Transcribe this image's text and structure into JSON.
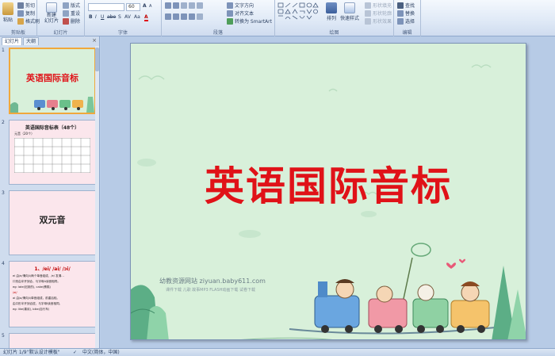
{
  "ribbon": {
    "clipboard": {
      "label": "剪贴板",
      "paste": "粘贴",
      "cut": "剪切",
      "copy": "复制",
      "format_painter": "格式刷"
    },
    "slides": {
      "label": "幻灯片",
      "new_slide_line1": "新建",
      "new_slide_line2": "幻灯片",
      "layout": "版式",
      "reset": "重设",
      "delete": "删除"
    },
    "font": {
      "label": "字体",
      "font_name": "",
      "font_size": "60",
      "grow": "A",
      "shrink": "A",
      "bold": "B",
      "italic": "I",
      "underline": "U",
      "strike": "abe",
      "shadow": "S",
      "spacing": "AV",
      "case": "Aa",
      "color": "A"
    },
    "paragraph": {
      "label": "段落",
      "text_direction": "文字方向",
      "align_text": "对齐文本",
      "smartart": "转换为 SmartArt"
    },
    "drawing": {
      "label": "绘图",
      "arrange": "排列",
      "quick_styles": "快速样式",
      "shape_fill": "形状填充",
      "shape_outline": "形状轮廓",
      "shape_effects": "形状效果"
    },
    "editing": {
      "label": "编辑",
      "find": "查找",
      "replace": "替换",
      "select": "选择"
    }
  },
  "panel": {
    "tab_slides": "幻灯片",
    "tab_outline": "大纲",
    "close": "×",
    "thumbnails": [
      {
        "num": "1",
        "title": "英语国际音标"
      },
      {
        "num": "2",
        "title": "英语国际音标表（48个）",
        "sub": "元音（20个）"
      },
      {
        "num": "3",
        "title": "双元音"
      },
      {
        "num": "4",
        "title": "1、/ei/  /ai/  /ɔi/",
        "lines": [
          "ei  由/e/滑向/i/两个单音组成，/e/ 发清...",
          "口形由半开到合，与字母A读音相同。",
          "eg: late(迟到的), cake(蛋糕)",
          "/ai/",
          "ai 由/a/滑向/i/单音组成，前重后轻。",
          "由口形半开到合拢，与字母I读音相同。",
          "eg: like(喜欢), bike(自行车)"
        ]
      },
      {
        "num": "5",
        "title": ""
      }
    ]
  },
  "slide": {
    "title": "英语国际音标",
    "watermark": "幼教资源网站  ziyuan.baby611.com",
    "watermark_sub": "课件下载  儿歌  故事MP3  FLASH动画下载  试卷下载"
  },
  "status": {
    "slide_info": "幻灯片 1/9",
    "theme": "\"默认设计模板\"",
    "language": "中文(简体，中国)"
  },
  "colors": {
    "title_red": "#e01218",
    "slide_bg": "#d8f0da",
    "ribbon_bg": "#dfe9f6"
  }
}
